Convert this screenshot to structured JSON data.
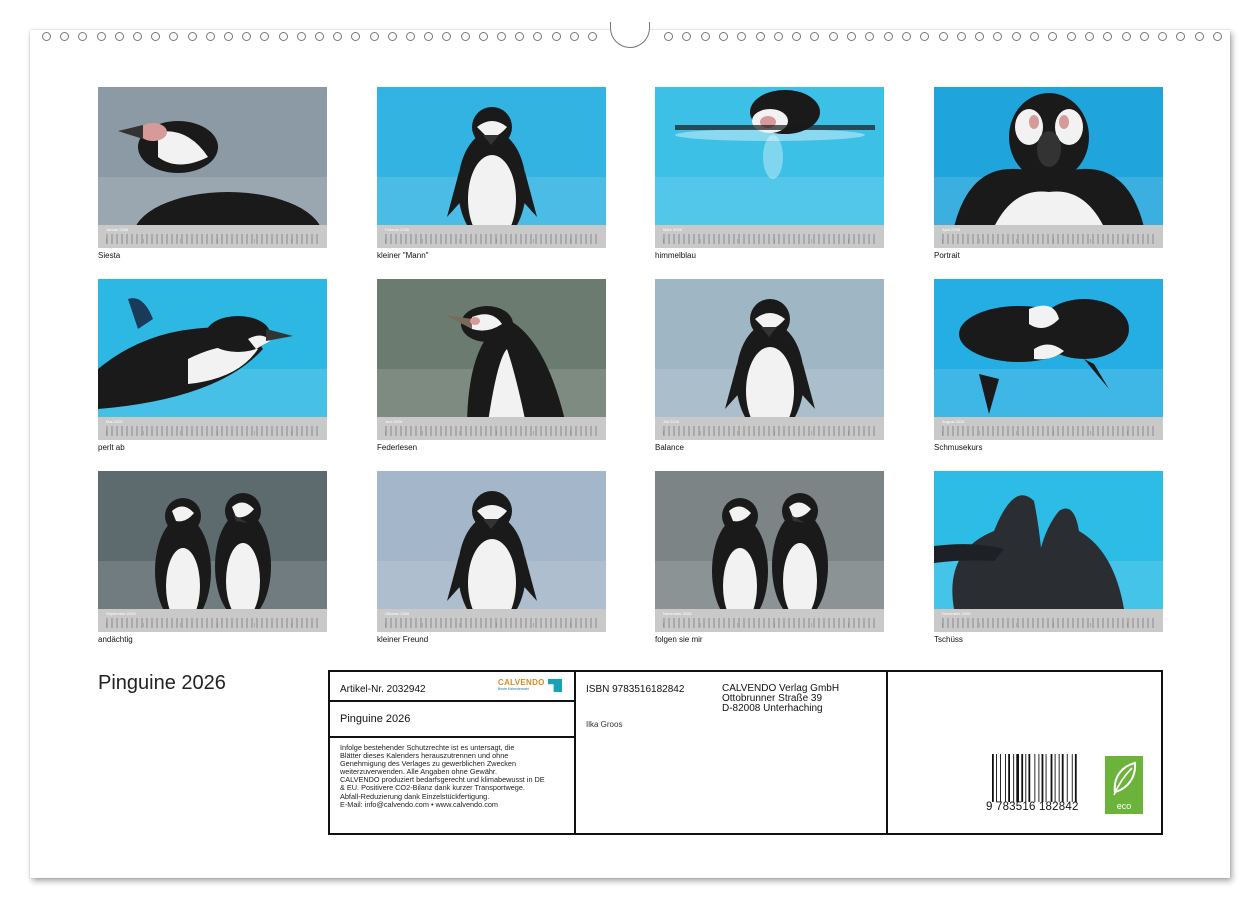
{
  "months": [
    {
      "caption": "Siesta",
      "month": "Januar 2026",
      "bg": "#8c9aa6",
      "type": "rest"
    },
    {
      "caption": "kleiner  \"Mann\"",
      "month": "Februar 2026",
      "bg": "#32b3e2",
      "type": "stand"
    },
    {
      "caption": "himmelblau",
      "month": "März 2026",
      "bg": "#3cc0e6",
      "type": "swim"
    },
    {
      "caption": "Portrait",
      "month": "April 2026",
      "bg": "#1fa4dc",
      "type": "face"
    },
    {
      "caption": "perlt ab",
      "month": "Mai 2026",
      "bg": "#2db8e4",
      "type": "swimside"
    },
    {
      "caption": "Federlesen",
      "month": "Juni 2026",
      "bg": "#6c7b70",
      "type": "half"
    },
    {
      "caption": "Balance",
      "month": "Juli 2026",
      "bg": "#9fb7c4",
      "type": "stand"
    },
    {
      "caption": "Schmusekurs",
      "month": "August 2026",
      "bg": "#24aee3",
      "type": "pair"
    },
    {
      "caption": "andächtig",
      "month": "September 2026",
      "bg": "#5d6a6e",
      "type": "pairstand"
    },
    {
      "caption": "kleiner Freund",
      "month": "Oktober 2026",
      "bg": "#a4b6c9",
      "type": "stand"
    },
    {
      "caption": "folgen sie mir",
      "month": "November 2026",
      "bg": "#7d8486",
      "type": "pairstand"
    },
    {
      "caption": "Tschüss",
      "month": "Dezember 2026",
      "bg": "#2cbce6",
      "type": "back"
    }
  ],
  "title": "Pinguine 2026",
  "info": {
    "article": "Artikel-Nr. 2032942",
    "title": "Pinguine 2026",
    "legal": [
      "Infolge bestehender Schutzrechte ist es untersagt, die",
      "Blätter dieses Kalenders herauszutrennen und ohne",
      "Genehmigung des Verlages zu gewerblichen Zwecken",
      "weiterzuverwenden. Alle Angaben ohne Gewähr.",
      "CALVENDO produziert bedarfsgerecht und klimabewusst in DE",
      "& EU. Positivere CO2-Bilanz dank kurzer Transportwege.",
      "Abfall-Reduzierung dank Einzelstückfertigung.",
      "E-Mail: info@calvendo.com • www.calvendo.com"
    ],
    "isbn": "ISBN 9783516182842",
    "author": "Ilka Groos",
    "publisher": [
      "CALVENDO Verlag GmbH",
      "Ottobrunner Straße 39",
      "D-82008 Unterhaching"
    ],
    "logo_word": "CALVENDO",
    "logo_sub": "Beste Kalenderwahl",
    "barcode_number": "9 783516 182842",
    "eco_label": "eco"
  },
  "colors": {
    "accent": "#d68b1e",
    "eco": "#6bb33a",
    "strip": "#c9c9c9"
  }
}
